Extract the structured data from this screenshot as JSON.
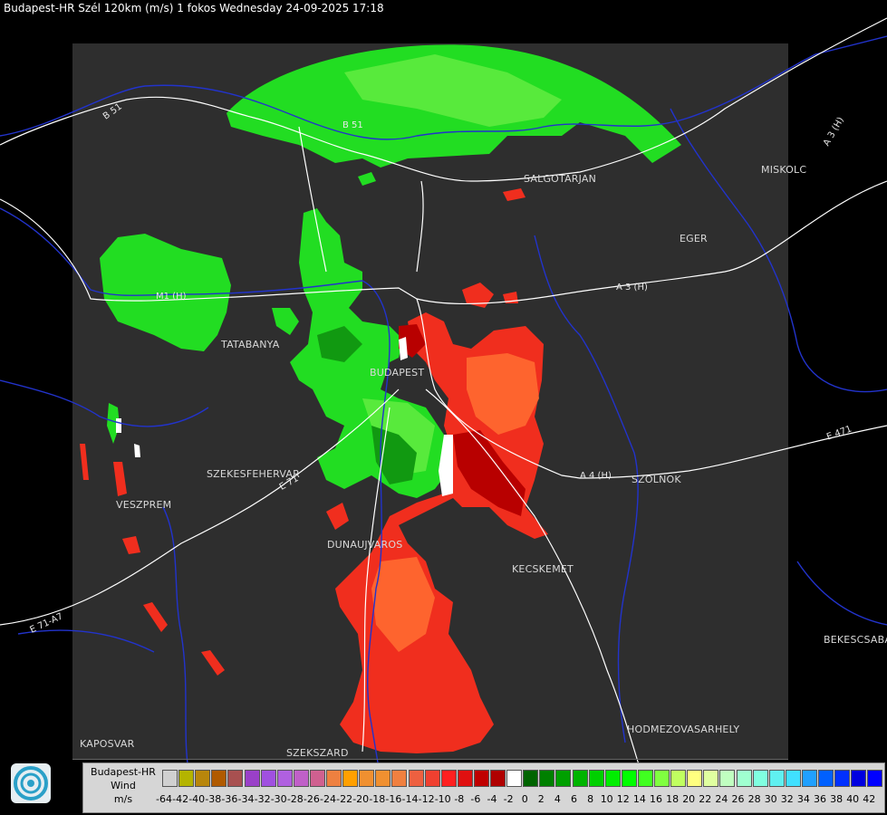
{
  "title": "Budapest-HR Szél 120km (m/s) 1 fokos Wednesday 24-09-2025 17:18",
  "cities": [
    {
      "name": "SALGOTARJAN"
    },
    {
      "name": "MISKOLC"
    },
    {
      "name": "EGER"
    },
    {
      "name": "TATABANYA"
    },
    {
      "name": "BUDAPEST"
    },
    {
      "name": "SZEKESFEHERVAR"
    },
    {
      "name": "VESZPREM"
    },
    {
      "name": "SZOLNOK"
    },
    {
      "name": "DUNAUJVAROS"
    },
    {
      "name": "KECSKEMET"
    },
    {
      "name": "BEKESCSABA"
    },
    {
      "name": "HODMEZOVASARHELY"
    },
    {
      "name": "KAPOSVAR"
    },
    {
      "name": "SZEKSZARD"
    }
  ],
  "roads": [
    "B 51",
    "B 51",
    "A 3 (H)",
    "A 3 (H)",
    "A 4 (H)",
    "E 471",
    "E 71-A7",
    "M1 (H)",
    "E 71"
  ],
  "legend": {
    "line1": "Budapest-HR",
    "line2": "Wind",
    "line3": "m/s",
    "ticks": [
      "-64",
      "-42",
      "-40",
      "-38",
      "-36",
      "-34",
      "-32",
      "-30",
      "-28",
      "-26",
      "-24",
      "-22",
      "-20",
      "-18",
      "-16",
      "-14",
      "-12",
      "-10",
      "-8",
      "-6",
      "-4",
      "-2",
      "0",
      "2",
      "4",
      "6",
      "8",
      "10",
      "12",
      "14",
      "16",
      "18",
      "20",
      "22",
      "24",
      "26",
      "28",
      "30",
      "32",
      "34",
      "36",
      "38",
      "40",
      "42"
    ],
    "colors": [
      "#d0d0d0",
      "#b4b400",
      "#b8860b",
      "#b05a00",
      "#a85050",
      "#9a40c8",
      "#a050e0",
      "#b060e0",
      "#c060c8",
      "#d06090",
      "#ee8040",
      "#ffa000",
      "#f09030",
      "#f09030",
      "#f08040",
      "#ee6040",
      "#f04030",
      "#ff2020",
      "#e01010",
      "#c00000",
      "#b00000",
      "#ffffff",
      "#006400",
      "#008000",
      "#00a000",
      "#00b400",
      "#00d000",
      "#00ee00",
      "#00ff00",
      "#40ff20",
      "#80ff40",
      "#c0ff60",
      "#ffff80",
      "#e0ffa0",
      "#c0ffc0",
      "#a0ffd0",
      "#80ffe0",
      "#60f0f0",
      "#40e0ff",
      "#20a0ff",
      "#0060ff",
      "#0030ff",
      "#0000e0",
      "#0000ff"
    ]
  }
}
